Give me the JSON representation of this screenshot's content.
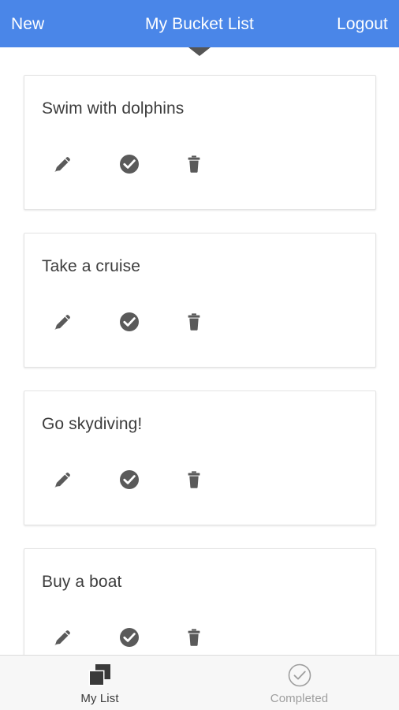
{
  "header": {
    "new_label": "New",
    "title": "My Bucket List",
    "logout_label": "Logout",
    "background_color": "#4a86e8",
    "text_color": "#ffffff",
    "chevron_color": "#555555"
  },
  "list": {
    "item_icon_color": "#5a5a5a",
    "card_border_color": "#e4e4e4",
    "card_background": "#ffffff",
    "title_color": "#3c3c3c",
    "items": [
      {
        "title": "Swim with dolphins",
        "edit_label": "Edit",
        "complete_label": "Mark complete",
        "delete_label": "Delete"
      },
      {
        "title": "Take a cruise",
        "edit_label": "Edit",
        "complete_label": "Mark complete",
        "delete_label": "Delete"
      },
      {
        "title": "Go skydiving!",
        "edit_label": "Edit",
        "complete_label": "Mark complete",
        "delete_label": "Delete"
      },
      {
        "title": "Buy a boat",
        "edit_label": "Edit",
        "complete_label": "Mark complete",
        "delete_label": "Delete"
      }
    ]
  },
  "bottom_nav": {
    "background_color": "#f7f7f7",
    "active_color": "#3a3a3a",
    "inactive_color": "#9e9e9e",
    "items": [
      {
        "label": "My List",
        "icon": "layers-icon",
        "active": true
      },
      {
        "label": "Completed",
        "icon": "check-circle-icon",
        "active": false
      }
    ]
  }
}
